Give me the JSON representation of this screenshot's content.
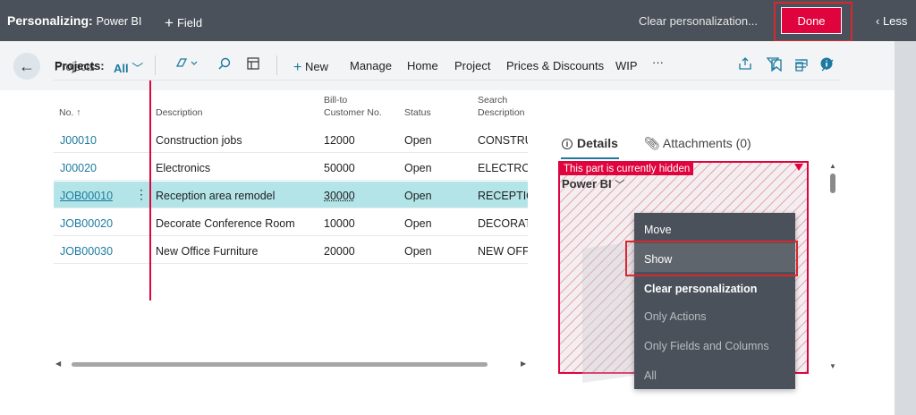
{
  "topbar": {
    "title": "Personalizing:",
    "subtitle": "Power BI",
    "add_field": "Field",
    "clear": "Clear personalization...",
    "done": "Done",
    "less": "Less"
  },
  "header": {
    "breadcrumb": "Projects"
  },
  "toolbar": {
    "label": "Projects:",
    "filter": "All",
    "new": "New",
    "manage": "Manage",
    "home": "Home",
    "project": "Project",
    "prices": "Prices & Discounts",
    "wip": "WIP",
    "more": "···"
  },
  "table": {
    "columns": {
      "no": "No. ↑",
      "description": "Description",
      "bill_to_1": "Bill-to",
      "bill_to_2": "Customer No.",
      "status": "Status",
      "search_1": "Search",
      "search_2": "Description"
    },
    "rows": [
      {
        "no": "J00010",
        "description": "Construction jobs",
        "bill": "12000",
        "status": "Open",
        "search": "CONSTRUCTION JOBS"
      },
      {
        "no": "J00020",
        "description": "Electronics",
        "bill": "50000",
        "status": "Open",
        "search": "ELECTRONICS"
      },
      {
        "no": "JOB00010",
        "description": "Reception area remodel",
        "bill": "30000",
        "status": "Open",
        "search": "RECEPTION AREA REMODEL"
      },
      {
        "no": "JOB00020",
        "description": "Decorate Conference Room",
        "bill": "10000",
        "status": "Open",
        "search": "DECORATE CONFERENCE ROOM"
      },
      {
        "no": "JOB00030",
        "description": "New Office Furniture",
        "bill": "20000",
        "status": "Open",
        "search": "NEW OFFICE FURNITURE"
      }
    ]
  },
  "factbox": {
    "tab_details": "Details",
    "tab_attachments": "Attachments (0)",
    "hidden_label": "This part is currently hidden",
    "part_title": "Power BI"
  },
  "menu": {
    "move": "Move",
    "show": "Show",
    "clear": "Clear personalization",
    "only_actions": "Only Actions",
    "only_fields": "Only Fields and Columns",
    "all": "All"
  },
  "colors": {
    "accent": "#1c7aa0",
    "done": "#e0043e",
    "topbar": "#4b515a",
    "selected_row": "#b3e5e8"
  }
}
